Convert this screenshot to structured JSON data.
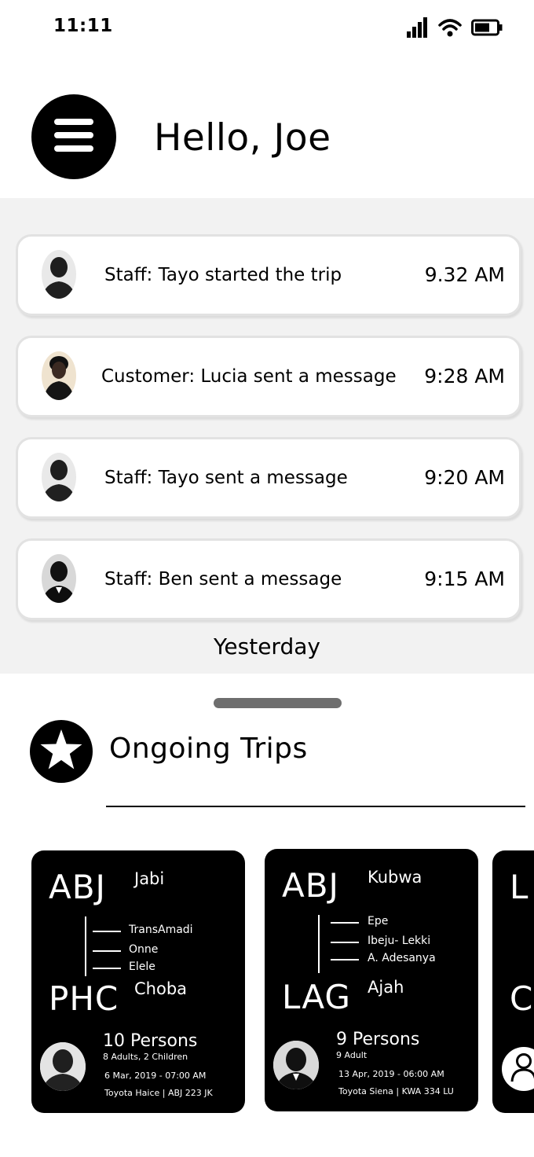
{
  "status_bar": {
    "time": "11:11"
  },
  "header": {
    "greeting": "Hello, Joe"
  },
  "notifications": [
    {
      "text": "Staff: Tayo started  the trip",
      "time": "9.32 AM"
    },
    {
      "text": "Customer: Lucia sent a message",
      "time": "9:28 AM"
    },
    {
      "text": "Staff: Tayo sent a message",
      "time": "9:20 AM"
    },
    {
      "text": "Staff: Ben sent a message",
      "time": "9:15 AM"
    }
  ],
  "yesterday_label": "Yesterday",
  "ongoing": {
    "title": "Ongoing Trips"
  },
  "trips": [
    {
      "from_code": "ABJ",
      "from_place": "Jabi",
      "stops": [
        "TransAmadi",
        "Onne",
        "Elele"
      ],
      "to_code": "PHC",
      "to_place": "Choba",
      "persons": "10 Persons",
      "breakdown": "8 Adults, 2 Children",
      "datetime": "6 Mar, 2019 - 07:00 AM",
      "vehicle": "Toyota Haice | ABJ 223 JK"
    },
    {
      "from_code": "ABJ",
      "from_place": "Kubwa",
      "stops": [
        "Epe",
        "Ibeju- Lekki",
        "A. Adesanya"
      ],
      "to_code": "LAG",
      "to_place": "Ajah",
      "persons": "9 Persons",
      "breakdown": "9 Adult",
      "datetime": "13 Apr, 2019 - 06:00 AM",
      "vehicle": "Toyota Siena | KWA 334 LU"
    },
    {
      "from_code": "L",
      "to_code": "C"
    }
  ]
}
